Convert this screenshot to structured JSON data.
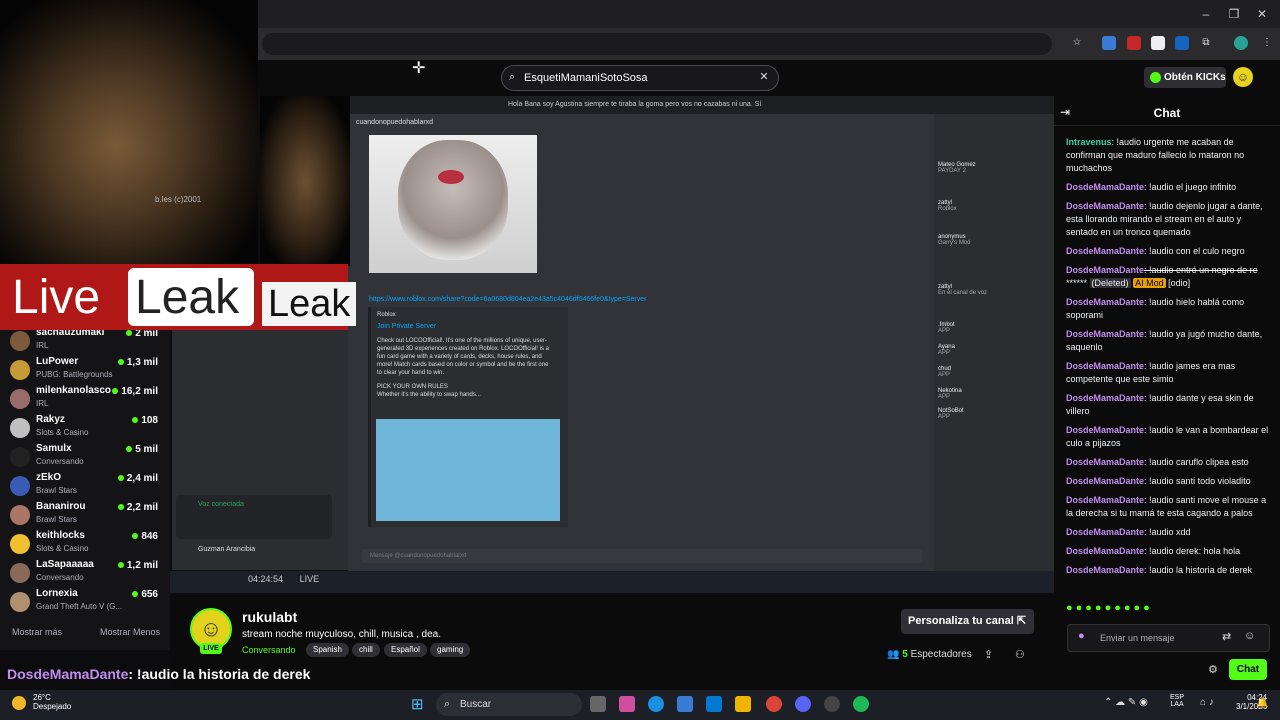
{
  "browser": {
    "extensions": [
      "bookmark-star",
      "ext-1",
      "ext-2",
      "ext-3",
      "ext-4",
      "extensions-puzzle",
      "profile"
    ]
  },
  "header": {
    "search_value": "EsquetiMamaniSotoSosa",
    "kicks_label": "Obtén KICKs"
  },
  "overlay": {
    "credit": "b.les (c)2001",
    "live": "Live",
    "leak": "Leak",
    "leak2": "Leak"
  },
  "sidebar": {
    "items": [
      {
        "name": "sachauzumaki",
        "category": "IRL",
        "viewers": "2 mil"
      },
      {
        "name": "LuPower",
        "category": "PUBG: Battlegrounds",
        "viewers": "1,3 mil"
      },
      {
        "name": "milenkanolasco",
        "category": "IRL",
        "viewers": "16,2 mil"
      },
      {
        "name": "Rakyz",
        "category": "Slots & Casino",
        "viewers": "108"
      },
      {
        "name": "Samulx",
        "category": "Conversando",
        "viewers": "5 mil"
      },
      {
        "name": "zEkO",
        "category": "Brawl Stars",
        "viewers": "2,4 mil"
      },
      {
        "name": "Bananirou",
        "category": "Brawl Stars",
        "viewers": "2,2 mil"
      },
      {
        "name": "keithlocks",
        "category": "Slots & Casino",
        "viewers": "846"
      },
      {
        "name": "LaSapaaaaa",
        "category": "Conversando",
        "viewers": "1,2 mil"
      },
      {
        "name": "Lornexia",
        "category": "Grand Theft Auto V (G...",
        "viewers": "656"
      }
    ],
    "show_more": "Mostrar más",
    "show_less": "Mostrar Menos"
  },
  "stream": {
    "discord_title": "Hola Bana soy Agustina siempre te tiraba la goma pero vos no cazabas ni una. Sí",
    "channel": "cuandonopuedohablarxd",
    "link": "https://www.roblox.com/share?code=6a0680d804ea2e43a5c4046df0466fe0&type=Server",
    "embed_source": "Roblox",
    "embed_title": "Join Private Server",
    "embed_body": "Check out LOCOOfficial!. It's one of the millions of unique, user-generated 3D experiences created on Roblox. LOCOOfficial! is a fun card game with a variety of cards, decks, house rules, and more! Match cards based on color or symbol and be the first one to clear your hand to win.",
    "embed_sub": "PICK YOUR OWN RULES",
    "embed_sub2": "Whether it's the ability to swap hands...",
    "members": [
      {
        "name": "Mateo Gomez",
        "status": "PAYDAY 2"
      },
      {
        "name": "zattyl",
        "status": "Roblox"
      },
      {
        "name": "anonymus",
        "status": "Garry's Mod"
      },
      {
        "name": "zattyl",
        "status": "En el canal de voz"
      },
      {
        "name": ".fmbot",
        "status": "APP"
      },
      {
        "name": "Ayana",
        "status": "APP"
      },
      {
        "name": "chud",
        "status": "APP"
      },
      {
        "name": "Nekotina",
        "status": "APP"
      },
      {
        "name": "NotSoBot",
        "status": "APP"
      }
    ],
    "voice": "Voz conectada",
    "user": "Guzman Arancibia",
    "live_time": "04:24:54",
    "live_label": "LIVE",
    "input_placeholder": "Mensaje @cuandonopuedohablarxd"
  },
  "info": {
    "username": "rukulabt",
    "title": "stream noche muyculoso, chill, musica , dea.",
    "category": "Conversando",
    "tags": [
      "Spanish",
      "chill",
      "Español",
      "gaming"
    ],
    "live_badge": "LIVE",
    "personaliza": "Personaliza tu canal",
    "viewers_count": "5",
    "viewers_label": "Espectadores",
    "bottom_user": "DosdeMamaDante",
    "bottom_text": ": !audio la historia de derek"
  },
  "chat": {
    "title": "Chat",
    "messages": [
      {
        "user": "Intravenus",
        "text": ": !audio urgente me acaban de confirman que maduro fallecio lo mataron no muchachos",
        "cls": "u1"
      },
      {
        "user": "DosdeMamaDante",
        "text": ": !audio el juego infinito",
        "cls": "u2"
      },
      {
        "user": "DosdeMamaDante",
        "text": ": !audio dejenlo jugar a dante, esta llorando mirando el stream en el auto y sentado en un tronco quemado",
        "cls": "u2"
      },
      {
        "user": "DosdeMamaDante",
        "text": ": !audio con el culo negro",
        "cls": "u2"
      },
      {
        "user": "DosdeMamaDante",
        "text": ": !audio hielo hablá como soporami",
        "cls": "u2"
      },
      {
        "user": "DosdeMamaDante",
        "text": ": !audio ya jugó mucho dante, saquenlo",
        "cls": "u2"
      },
      {
        "user": "DosdeMamaDante",
        "text": ": !audio james era mas competente que este simio",
        "cls": "u2"
      },
      {
        "user": "DosdeMamaDante",
        "text": ": !audio dante y esa skin de villero",
        "cls": "u2"
      },
      {
        "user": "DosdeMamaDante",
        "text": ": !audio le van a bombardear el culo a pijazos",
        "cls": "u2"
      },
      {
        "user": "DosdeMamaDante",
        "text": ": !audio caruflo clipea esto",
        "cls": "u2"
      },
      {
        "user": "DosdeMamaDante",
        "text": ": !audio santi todo violadito",
        "cls": "u2"
      },
      {
        "user": "DosdeMamaDante",
        "text": ": !audio santi move el mouse a la derecha si tu mamá te esta cagando a palos",
        "cls": "u2"
      },
      {
        "user": "DosdeMamaDante",
        "text": ": !audio xdd",
        "cls": "u2"
      },
      {
        "user": "DosdeMamaDante",
        "text": ": !audio derek: hola hola",
        "cls": "u2"
      },
      {
        "user": "DosdeMamaDante",
        "text": ": !audio la historia de derek",
        "cls": "u2"
      }
    ],
    "deleted_msg": {
      "user": "DosdeMamaDante",
      "text": ": !audio entró un negro de re",
      "stars": "******",
      "deleted": "(Deleted)",
      "mod": "AI Mod",
      "reason": "[odio]"
    },
    "input_placeholder": "Enviar un mensaje",
    "send": "Chat"
  },
  "taskbar": {
    "temp": "26°C",
    "weather": "Despejado",
    "search": "Buscar",
    "lang1": "ESP",
    "lang2": "LAA",
    "time": "04:24",
    "date": "3/1/2026"
  }
}
